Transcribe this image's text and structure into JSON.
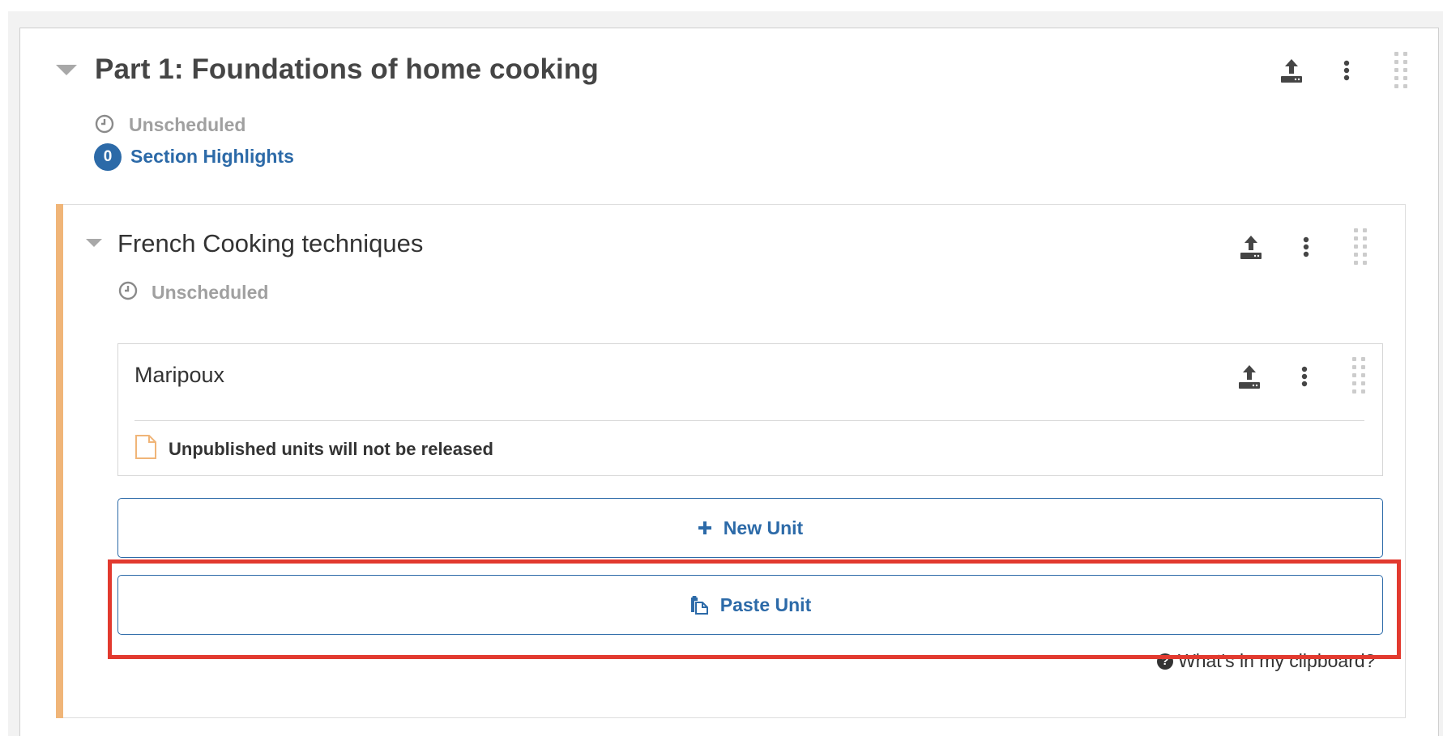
{
  "section": {
    "title": "Part 1: Foundations of home cooking",
    "schedule_status": "Unscheduled",
    "highlights_count": "0",
    "highlights_label": "Section Highlights"
  },
  "subsection": {
    "title": "French Cooking techniques",
    "schedule_status": "Unscheduled"
  },
  "unit": {
    "title": "Maripoux",
    "warning": "Unpublished units will not be released"
  },
  "actions": {
    "new_unit_label": "New Unit",
    "paste_unit_label": "Paste Unit",
    "clipboard_help": "What's in my clipboard?"
  },
  "icons": {
    "publish": "publish-icon",
    "menu": "vertical-ellipsis-icon",
    "drag": "drag-handle-icon",
    "clock": "clock-icon",
    "document": "document-icon",
    "plus": "plus-icon",
    "paste": "paste-icon",
    "help": "question-circle-icon"
  },
  "colors": {
    "accent_link": "#2c6aa8",
    "subsection_bar": "#f0b578",
    "highlight_box": "#e23a2f",
    "muted_text": "#a0a0a0"
  }
}
